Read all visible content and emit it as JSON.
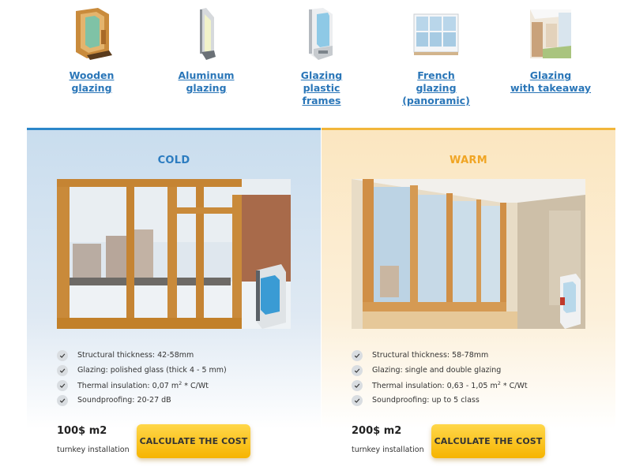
{
  "categories": [
    {
      "label": "Wooden\nglazing",
      "icon": "wooden-frame-icon"
    },
    {
      "label": "Aluminum\nglazing",
      "icon": "aluminum-frame-icon"
    },
    {
      "label": "Glazing\nplastic\nframes",
      "icon": "plastic-frame-icon"
    },
    {
      "label": "French\nglazing\n(panoramic)",
      "icon": "french-window-icon"
    },
    {
      "label": "Glazing\nwith takeaway",
      "icon": "balcony-takeaway-icon"
    }
  ],
  "cold": {
    "title": "COLD",
    "features": [
      {
        "text": "Structural thickness: 42-58mm"
      },
      {
        "text": "Glazing: polished glass (thick 4 - 5 mm)"
      },
      {
        "text": "Thermal insulation: 0,07 m",
        "sup": "2",
        "tail": " * C/Wt"
      },
      {
        "text": "Soundproofing: 20-27 dB"
      }
    ],
    "price": "100$ m2",
    "note": "turnkey installation",
    "button": "CALCULATE THE COST"
  },
  "warm": {
    "title": "WARM",
    "features": [
      {
        "text": "Structural thickness: 58-78mm"
      },
      {
        "text": "Glazing: single and double glazing"
      },
      {
        "text": "Thermal insulation: 0,63 - 1,05 m",
        "sup": "2",
        "tail": " * C/Wt"
      },
      {
        "text": "Soundproofing: up to 5 class"
      }
    ],
    "price": "200$ m2",
    "note": "turnkey installation",
    "button": "CALCULATE THE COST"
  },
  "colors": {
    "link": "#2a76b8",
    "cold_accent": "#2c86c9",
    "warm_accent": "#f2b63a",
    "button": "#f6b400"
  }
}
